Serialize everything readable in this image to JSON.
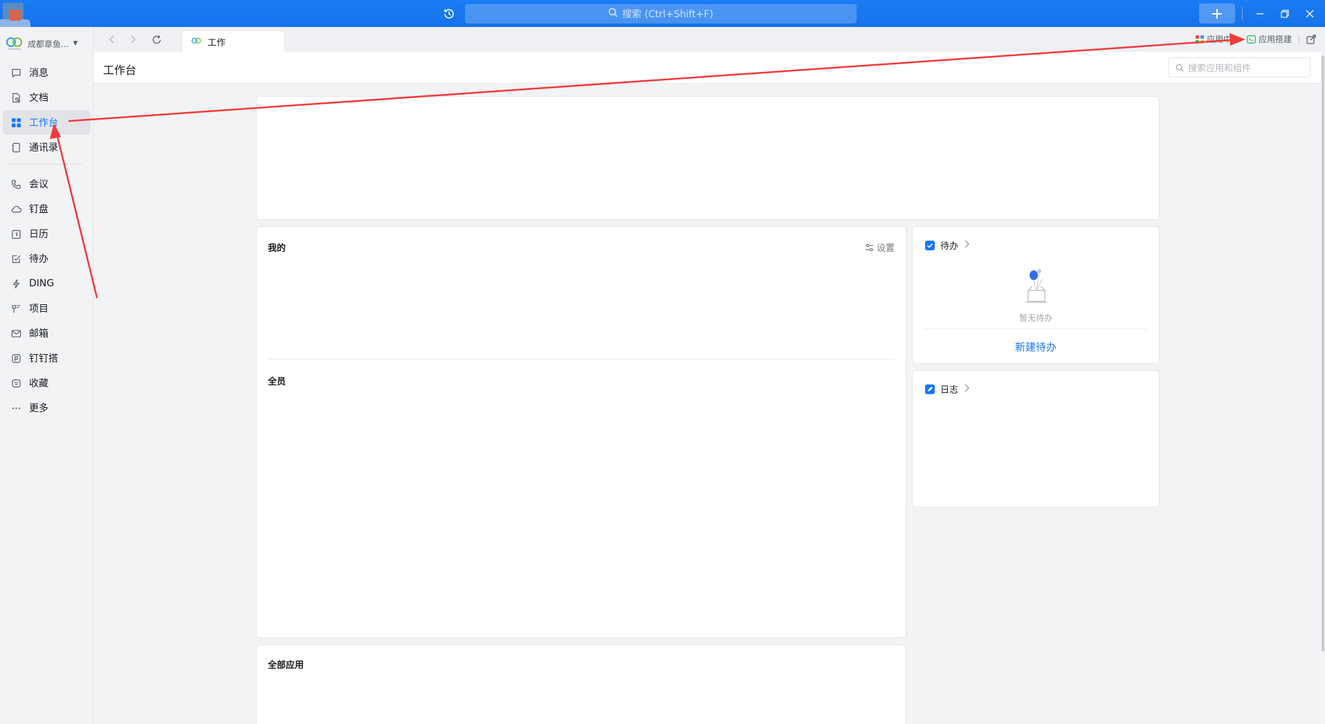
{
  "titlebar": {
    "search_placeholder": "搜索 (Ctrl+Shift+F)"
  },
  "org": {
    "name": "成都章鱼..."
  },
  "nav": {
    "items": [
      {
        "label": "消息"
      },
      {
        "label": "文档"
      },
      {
        "label": "工作台"
      },
      {
        "label": "通讯录"
      },
      {
        "label": "会议"
      },
      {
        "label": "钉盘"
      },
      {
        "label": "日历"
      },
      {
        "label": "待办"
      },
      {
        "label": "DING"
      },
      {
        "label": "项目"
      },
      {
        "label": "邮箱"
      },
      {
        "label": "钉钉搭"
      },
      {
        "label": "收藏"
      },
      {
        "label": "更多"
      }
    ]
  },
  "tabs": {
    "active_label": "工作",
    "right": {
      "app_center": "应用中心",
      "app_build": "应用搭建"
    }
  },
  "page": {
    "title": "工作台",
    "app_search_placeholder": "搜索应用和组件"
  },
  "mine": {
    "title": "我的",
    "settings_label": "设置",
    "all_members_title": "全员"
  },
  "all_apps": {
    "title": "全部应用"
  },
  "todo": {
    "title": "待办",
    "empty_text": "暂无待办",
    "new_label": "新建待办"
  },
  "log": {
    "title": "日志"
  },
  "colors": {
    "titlebar": "#1677ff",
    "accent": "#1677ff",
    "annotation": "#f03a3a"
  }
}
